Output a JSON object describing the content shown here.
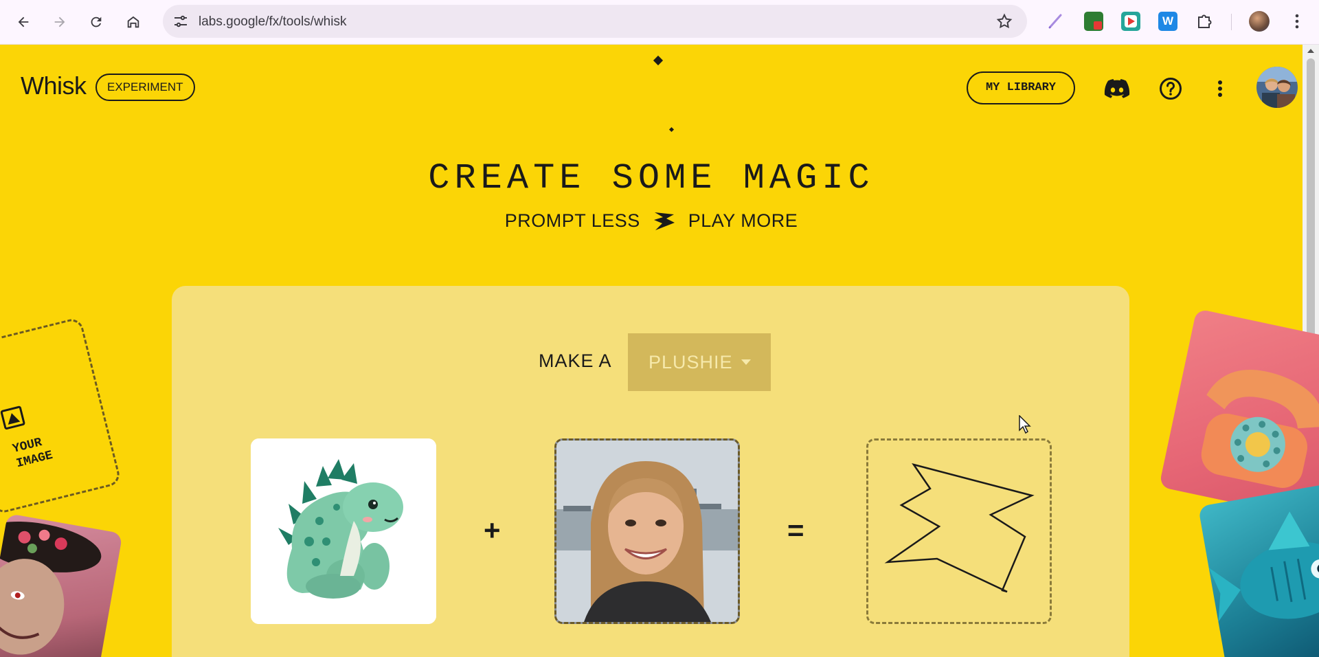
{
  "browser": {
    "url": "labs.google/fx/tools/whisk"
  },
  "app": {
    "logo": "Whisk",
    "badge": "EXPERIMENT",
    "library_button": "MY LIBRARY"
  },
  "hero": {
    "title": "CREATE SOME MAGIC",
    "sub_left": "PROMPT LESS",
    "sub_right": "PLAY MORE"
  },
  "composer": {
    "make_a_label": "MAKE A",
    "style_value": "PLUSHIE",
    "plus": "+",
    "equals": "="
  },
  "side_cards": {
    "your_image_label_line1": "YOUR",
    "your_image_label_line2": "IMAGE"
  },
  "colors": {
    "page_background": "#fbd506",
    "card_background": "#f5df7a",
    "dropdown_background": "#d3b85b",
    "text": "#1a1a1a"
  },
  "icons": [
    "back-icon",
    "forward-icon",
    "reload-icon",
    "home-icon",
    "site-settings-icon",
    "bookmark-star-icon",
    "extensions-icon",
    "discord-icon",
    "help-icon",
    "more-vert-icon",
    "image-icon",
    "sparkle-icon"
  ]
}
